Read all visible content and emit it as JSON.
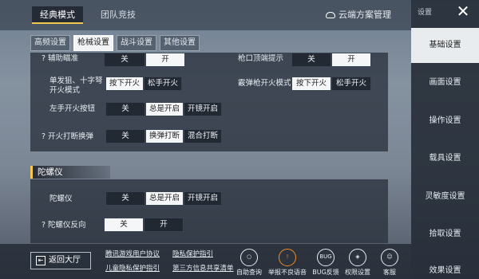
{
  "top_tabs": {
    "classic": "经典模式",
    "team": "团队竞技"
  },
  "cloud": "云端方案管理",
  "settings_label": "设置",
  "sub_tabs": [
    "高频设置",
    "枪械设置",
    "战斗设置",
    "其他设置"
  ],
  "rows": {
    "row0_left": {
      "label": "辅助瞄准",
      "opts": [
        "关",
        "开"
      ]
    },
    "row0_right": {
      "label": "枪口顶端提示",
      "opts": [
        "关",
        "开"
      ]
    },
    "row1_left": {
      "label": "单发狙、十字弩开火模式",
      "opts": [
        "按下开火",
        "松手开火"
      ]
    },
    "row1_right": {
      "label": "霰弹枪开火模式",
      "opts": [
        "按下开火",
        "松手开火"
      ]
    },
    "row2": {
      "label": "左手开火按钮",
      "opts": [
        "关",
        "总是开启",
        "开镜开启"
      ]
    },
    "row3": {
      "label": "开火打断换弹",
      "opts": [
        "关",
        "换弹打断",
        "混合打断"
      ]
    }
  },
  "gyro": {
    "title": "陀螺仪",
    "row1": {
      "label": "陀螺仪",
      "opts": [
        "关",
        "总是开启",
        "开镜开启"
      ]
    },
    "row2": {
      "label": "陀螺仪反向",
      "opts": [
        "关",
        "开"
      ]
    }
  },
  "sidebar": [
    "基础设置",
    "画面设置",
    "操作设置",
    "载具设置",
    "灵敏度设置",
    "拾取设置",
    "效果设置"
  ],
  "bottom": {
    "back": "返回大厅",
    "links": [
      "腾讯游戏用户协议",
      "隐私保护指引",
      "儿童隐私保护指引",
      "第三方信息共享清单"
    ],
    "icons": [
      {
        "label": "自助查询",
        "icon": "search-icon",
        "glyph": "○"
      },
      {
        "label": "举报不良语音",
        "icon": "warning-icon",
        "glyph": "!"
      },
      {
        "label": "BUG反馈",
        "icon": "bug-icon",
        "glyph": "BUG"
      },
      {
        "label": "权限设置",
        "icon": "shield-icon",
        "glyph": "◈"
      },
      {
        "label": "客服",
        "icon": "support-icon",
        "glyph": "☺"
      }
    ]
  },
  "q_mark": "?",
  "close_glyph": "✕",
  "back_glyph": "⇤"
}
